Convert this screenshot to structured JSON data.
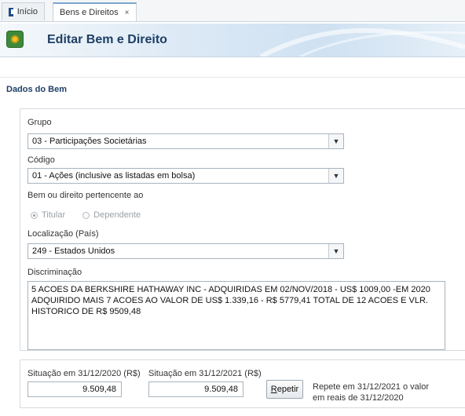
{
  "tabs": [
    {
      "label": "Início",
      "icon": "home-icon"
    },
    {
      "label": "Bens e Direitos",
      "close": "×"
    }
  ],
  "header": {
    "title": "Editar Bem e Direito",
    "icon": "money-icon"
  },
  "section": {
    "title": "Dados do Bem"
  },
  "form": {
    "grupo_label": "Grupo",
    "grupo_value": "03 - Participações Societárias",
    "codigo_label": "Código",
    "codigo_value": "01 - Ações (inclusive as listadas em bolsa)",
    "pertence_label": "Bem ou direito pertencente ao",
    "radio_titular": "Titular",
    "radio_dependente": "Dependente",
    "local_label": "Localização (País)",
    "local_value": "249 - Estados Unidos",
    "discriminacao_label": "Discriminação",
    "discriminacao_value": "5 ACOES DA BERKSHIRE HATHAWAY INC - ADQUIRIDAS EM 02/NOV/2018 - US$ 1009,00 -EM 2020\nADQUIRIDO MAIS 7 ACOES AO VALOR DE US$ 1.339,16 - R$ 5779,41 TOTAL DE 12 ACOES E VLR.\nHISTORICO DE R$ 9509,48"
  },
  "situacao": {
    "label_2020": "Situação em 31/12/2020 (R$)",
    "value_2020": "9.509,48",
    "label_2021": "Situação em 31/12/2021 (R$)",
    "value_2021": "9.509,48",
    "repetir_prefix": "R",
    "repetir_rest": "epetir",
    "note_line1": "Repete em 31/12/2021 o valor",
    "note_line2": "em reais de 31/12/2020"
  }
}
